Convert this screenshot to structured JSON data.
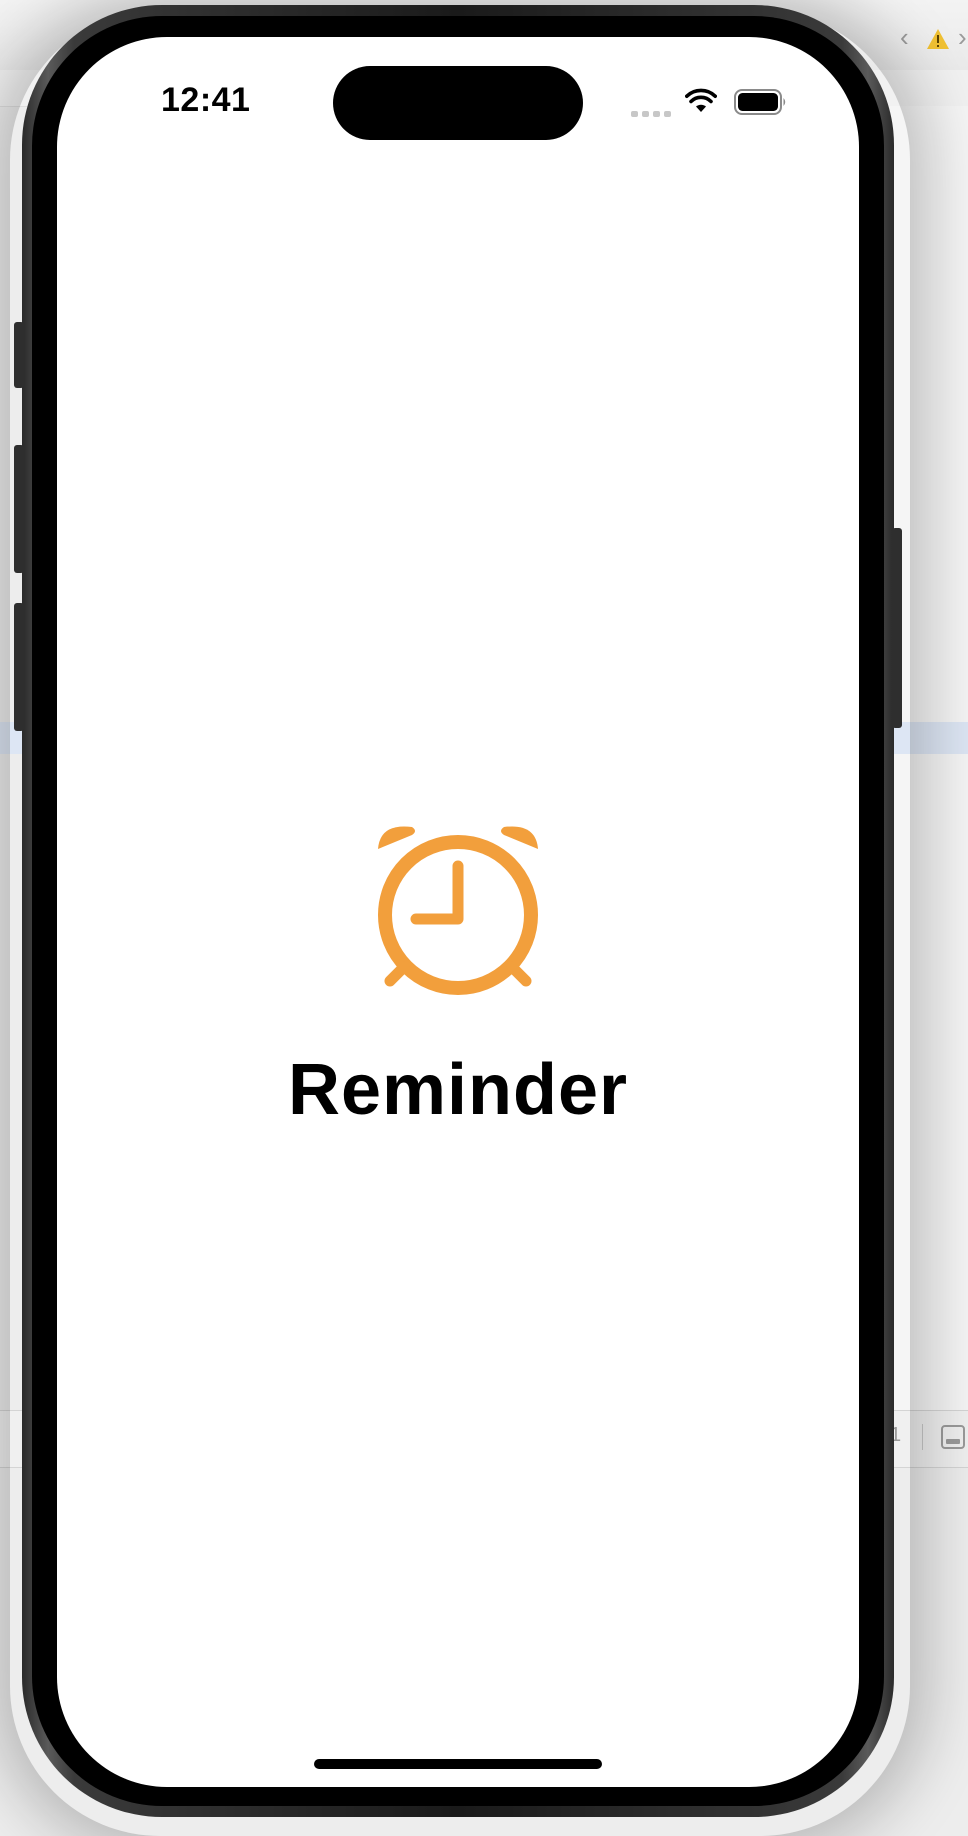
{
  "status_bar": {
    "time": "12:41",
    "signal": "signal-dots-icon",
    "wifi": "wifi-icon",
    "battery": "battery-full-icon"
  },
  "app": {
    "title": "Reminder",
    "icon": "alarm-clock-icon",
    "accent_color": "#F29F3C"
  },
  "xcode": {
    "nav_back": "‹",
    "nav_forward": "›",
    "line_number": "1"
  }
}
